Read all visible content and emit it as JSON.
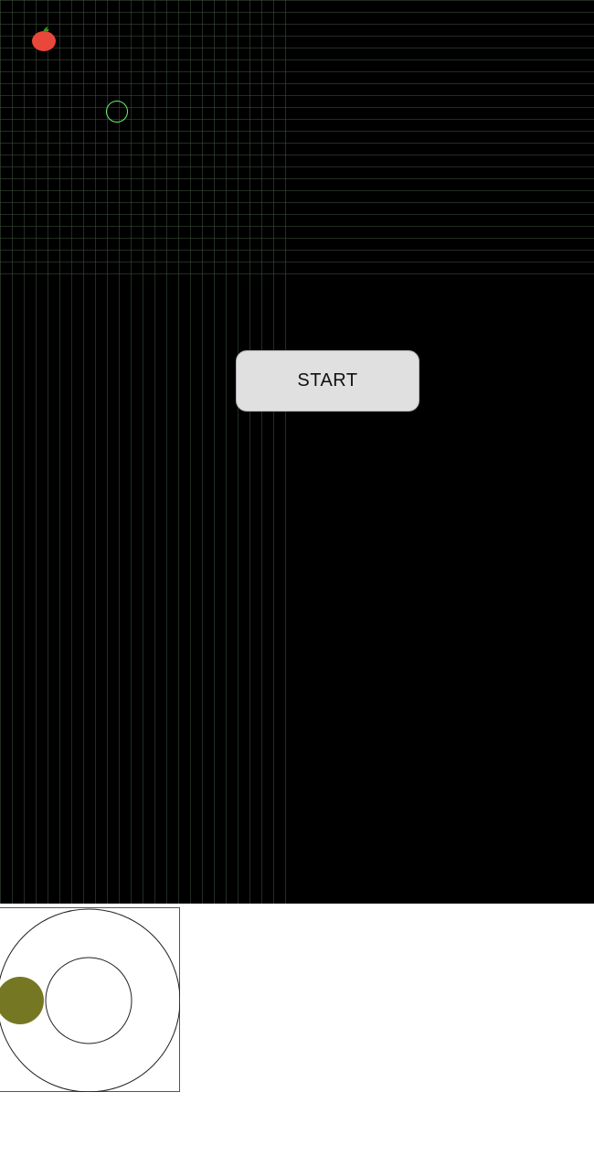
{
  "game": {
    "start_label": "START",
    "apple_icon": "apple-icon",
    "snake_color": "#6cf26c",
    "apple_color": "#e8473a",
    "grid_color": "#3c503c",
    "board_color": "#000000"
  },
  "joystick": {
    "knob_color": "#757723",
    "ring_color": "#000000"
  }
}
